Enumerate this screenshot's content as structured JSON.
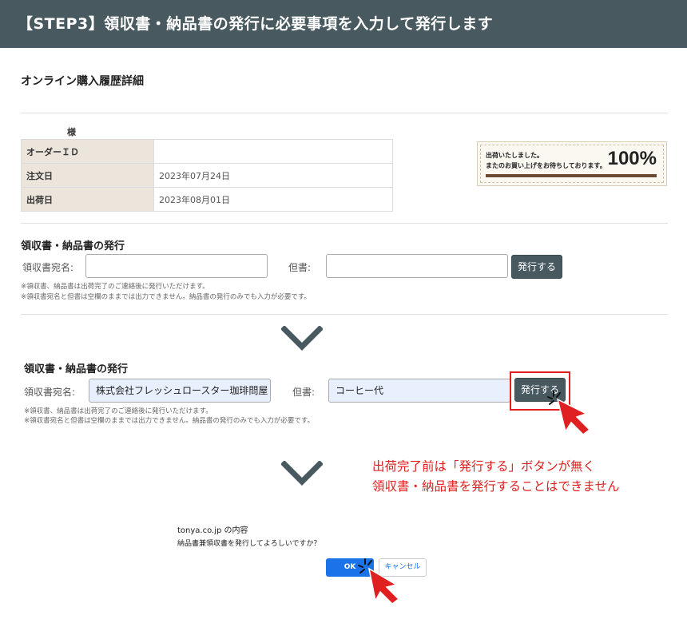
{
  "header": {
    "title": "【STEP3】領収書・納品書の発行に必要事項を入力して発行します"
  },
  "page": {
    "title": "オンライン購入履歴詳細"
  },
  "customer": {
    "honorific": "様"
  },
  "order": {
    "rows": [
      {
        "label": "オーダーＩＤ",
        "value": ""
      },
      {
        "label": "注文日",
        "value": "2023年07月24日"
      },
      {
        "label": "出荷日",
        "value": "2023年08月01日"
      }
    ]
  },
  "banner": {
    "line1": "出荷いたしました。",
    "line2": "またのお買い上げをお待ちしております。",
    "percent": "100%",
    "bar_color": "#6b4a33"
  },
  "form_empty": {
    "section_title": "領収書・納品書の発行",
    "recipient_label": "領収書宛名:",
    "recipient_value": "",
    "proviso_label": "但書:",
    "proviso_value": "",
    "issue_button": "発行する",
    "note1": "※領収書、納品書は出荷完了のご連絡後に発行いただけます。",
    "note2": "※領収書宛名と但書は空欄のままでは出力できません。納品書の発行のみでも入力が必要です。"
  },
  "form_filled": {
    "section_title": "領収書・納品書の発行",
    "recipient_label": "領収書宛名:",
    "recipient_value": "株式会社フレッシュロースター珈琲問屋",
    "proviso_label": "但書:",
    "proviso_value": "コーヒー代",
    "issue_button": "発行する",
    "note1": "※領収書、納品書は出荷完了のご連絡後に発行いただけます。",
    "note2": "※領収書宛名と但書は空欄のままでは出力できません。納品書の発行のみでも入力が必要です。"
  },
  "annotation": {
    "line1": "出荷完了前は「発行する」ボタンが無く",
    "line2": "領収書・納品書を発行することはできません",
    "color": "#e02020"
  },
  "dialog": {
    "origin": "tonya.co.jp の内容",
    "message": "納品書兼領収書を発行してよろしいですか？",
    "ok_label": "OK",
    "cancel_label": "キャンセル"
  },
  "icons": {
    "step_arrow": "chevron-down-icon",
    "pointer": "red-arrow-cursor-icon"
  },
  "colors": {
    "header_bg": "#485a60",
    "button_bg": "#485a60",
    "highlight": "#e02020",
    "ok_blue": "#1a73e8"
  }
}
